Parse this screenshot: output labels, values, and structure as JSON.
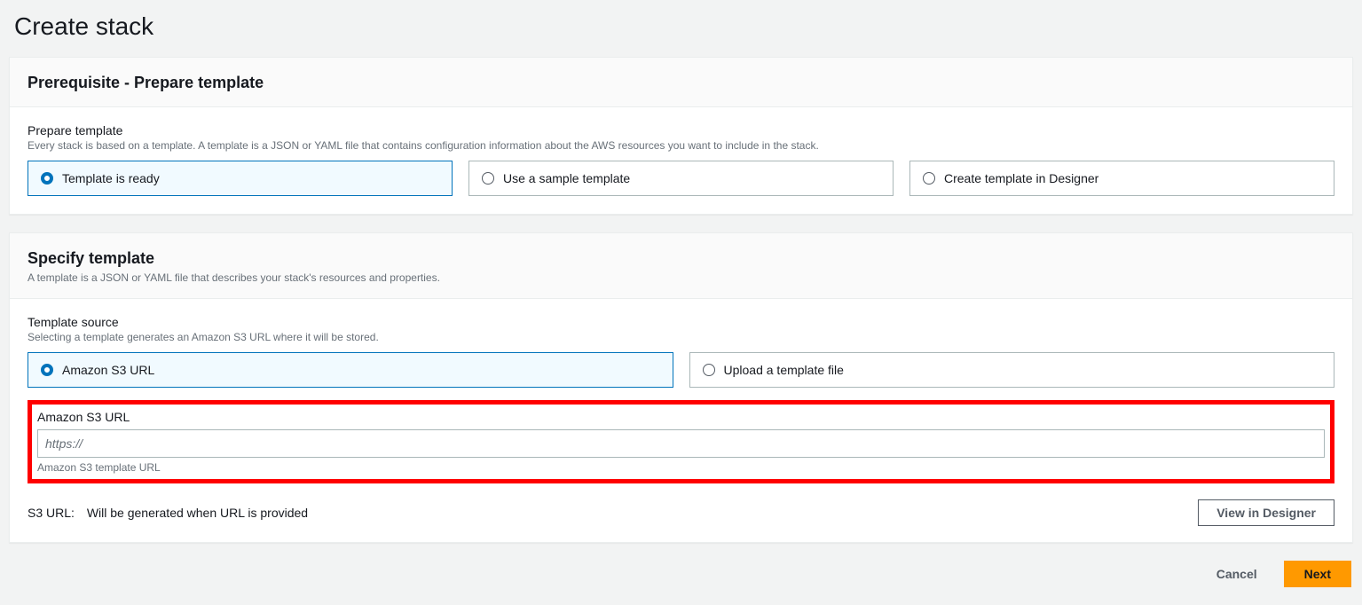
{
  "page": {
    "title": "Create stack"
  },
  "prerequisite": {
    "header": "Prerequisite - Prepare template",
    "prepare_label": "Prepare template",
    "prepare_desc": "Every stack is based on a template. A template is a JSON or YAML file that contains configuration information about the AWS resources you want to include in the stack.",
    "options": [
      {
        "label": "Template is ready"
      },
      {
        "label": "Use a sample template"
      },
      {
        "label": "Create template in Designer"
      }
    ]
  },
  "specify": {
    "header": "Specify template",
    "subtitle": "A template is a JSON or YAML file that describes your stack's resources and properties.",
    "source_label": "Template source",
    "source_desc": "Selecting a template generates an Amazon S3 URL where it will be stored.",
    "options": [
      {
        "label": "Amazon S3 URL"
      },
      {
        "label": "Upload a template file"
      }
    ],
    "s3_field_label": "Amazon S3 URL",
    "s3_placeholder": "https://",
    "s3_helper": "Amazon S3 template URL",
    "s3_url_status_label": "S3 URL:",
    "s3_url_status_value": "Will be generated when URL is provided",
    "view_designer": "View in Designer"
  },
  "actions": {
    "cancel": "Cancel",
    "next": "Next"
  }
}
